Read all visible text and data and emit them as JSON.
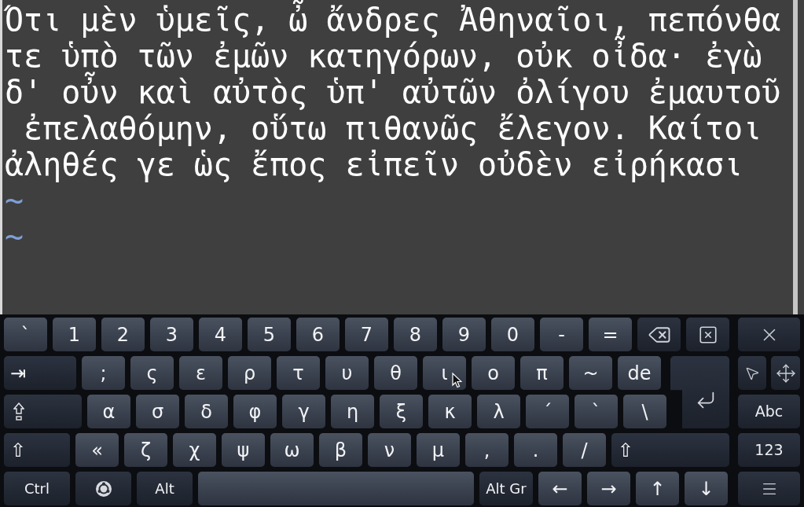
{
  "editor": {
    "lines": [
      "Ότι μὲν ὑμεῖς, ὦ ἄνδρες Ἀθηναῖοι, πεπόνθα",
      "τε ὑπὸ τῶν ἐμῶν κατηγόρων, οὐκ οἶδα· ἐγὼ",
      "δ' οὖν καὶ αὐτὸς ὑπ' αὐτῶν ὀλίγου ἐμαυτοῦ",
      " ἐπελαθόμην, οὕτω πιθανῶς ἔλεγον. Καίτοι",
      "ἀληθές γε ὡς ἔπος εἰπεῖν οὐδὲν εἰρήκασι"
    ],
    "empty_line_markers": [
      "~",
      "~"
    ]
  },
  "keyboard": {
    "row_1": [
      {
        "kind": "char",
        "label": "`"
      },
      {
        "kind": "char",
        "label": "1"
      },
      {
        "kind": "char",
        "label": "2"
      },
      {
        "kind": "char",
        "label": "3"
      },
      {
        "kind": "char",
        "label": "4"
      },
      {
        "kind": "char",
        "label": "5"
      },
      {
        "kind": "char",
        "label": "6"
      },
      {
        "kind": "char",
        "label": "7"
      },
      {
        "kind": "char",
        "label": "8"
      },
      {
        "kind": "char",
        "label": "9"
      },
      {
        "kind": "char",
        "label": "0"
      },
      {
        "kind": "char",
        "label": "-"
      },
      {
        "kind": "char",
        "label": "="
      },
      {
        "kind": "backspace"
      },
      {
        "kind": "delete"
      }
    ],
    "row_2": [
      {
        "kind": "tab",
        "label": "⇥"
      },
      {
        "kind": "char",
        "label": ";"
      },
      {
        "kind": "char",
        "label": "ς"
      },
      {
        "kind": "char",
        "label": "ε"
      },
      {
        "kind": "char",
        "label": "ρ"
      },
      {
        "kind": "char",
        "label": "τ"
      },
      {
        "kind": "char",
        "label": "υ"
      },
      {
        "kind": "char",
        "label": "θ"
      },
      {
        "kind": "char",
        "label": "ι"
      },
      {
        "kind": "char",
        "label": "ο"
      },
      {
        "kind": "char",
        "label": "π"
      },
      {
        "kind": "char",
        "label": "~"
      },
      {
        "kind": "char",
        "label": "de"
      }
    ],
    "row_3": [
      {
        "kind": "capslock"
      },
      {
        "kind": "char",
        "label": "α"
      },
      {
        "kind": "char",
        "label": "σ"
      },
      {
        "kind": "char",
        "label": "δ"
      },
      {
        "kind": "char",
        "label": "φ"
      },
      {
        "kind": "char",
        "label": "γ"
      },
      {
        "kind": "char",
        "label": "η"
      },
      {
        "kind": "char",
        "label": "ξ"
      },
      {
        "kind": "char",
        "label": "κ"
      },
      {
        "kind": "char",
        "label": "λ"
      },
      {
        "kind": "char",
        "label": "´"
      },
      {
        "kind": "char",
        "label": "`"
      },
      {
        "kind": "char",
        "label": "\\"
      }
    ],
    "row_4": [
      {
        "kind": "shift_left",
        "label": "⇧"
      },
      {
        "kind": "char",
        "label": "«"
      },
      {
        "kind": "char",
        "label": "ζ"
      },
      {
        "kind": "char",
        "label": "χ"
      },
      {
        "kind": "char",
        "label": "ψ"
      },
      {
        "kind": "char",
        "label": "ω"
      },
      {
        "kind": "char",
        "label": "β"
      },
      {
        "kind": "char",
        "label": "ν"
      },
      {
        "kind": "char",
        "label": "μ"
      },
      {
        "kind": "char",
        "label": ","
      },
      {
        "kind": "char",
        "label": "."
      },
      {
        "kind": "char",
        "label": "/"
      },
      {
        "kind": "shift_right",
        "label": "⇧"
      }
    ],
    "row_5": [
      {
        "kind": "ctrl",
        "label": "Ctrl"
      },
      {
        "kind": "logo"
      },
      {
        "kind": "alt",
        "label": "Alt"
      },
      {
        "kind": "space"
      },
      {
        "kind": "altgr",
        "label": "Alt Gr"
      },
      {
        "kind": "char",
        "label": "←"
      },
      {
        "kind": "char",
        "label": "→"
      },
      {
        "kind": "char",
        "label": "↑"
      },
      {
        "kind": "char",
        "label": "↓"
      }
    ],
    "side": [
      {
        "kind": "hide"
      },
      {
        "kind": "pointer_move"
      },
      {
        "kind": "mode",
        "label": "Abc"
      },
      {
        "kind": "mode",
        "label": "123"
      },
      {
        "kind": "menu"
      }
    ]
  }
}
